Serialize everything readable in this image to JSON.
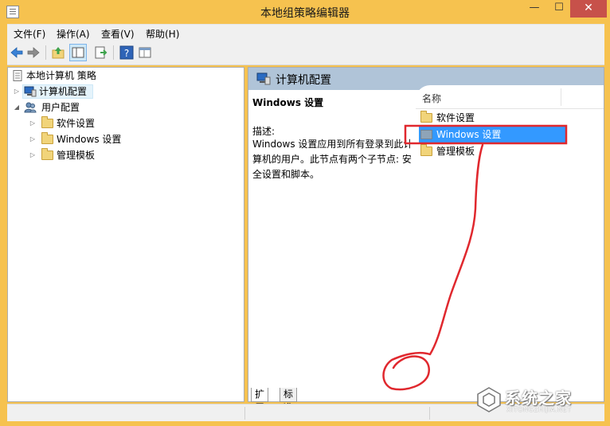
{
  "window": {
    "title": "本地组策略编辑器",
    "minimize_glyph": "—",
    "maximize_glyph": "☐",
    "close_glyph": "✕"
  },
  "menu": [
    {
      "label": "文件(F)"
    },
    {
      "label": "操作(A)"
    },
    {
      "label": "查看(V)"
    },
    {
      "label": "帮助(H)"
    }
  ],
  "toolbar": {
    "icons": [
      "back-icon",
      "forward-icon",
      "up-folder-icon",
      "show-hide-tree-icon",
      "export-list-icon",
      "help-icon",
      "properties-icon"
    ]
  },
  "tree": {
    "root": "本地计算机 策略",
    "computer_config": "计算机配置",
    "user_config": "用户配置",
    "children": [
      {
        "label": "软件设置"
      },
      {
        "label": "Windows 设置"
      },
      {
        "label": "管理模板"
      }
    ]
  },
  "details": {
    "header": "计算机配置",
    "selected_title": "Windows 设置",
    "description_label": "描述:",
    "description_text": "Windows 设置应用到所有登录到此计算机的用户。此节点有两个子节点: 安全设置和脚本。",
    "column_name": "名称",
    "items": [
      {
        "label": "软件设置"
      },
      {
        "label": "Windows 设置"
      },
      {
        "label": "管理模板"
      }
    ],
    "selected_index": 1
  },
  "tabs": [
    {
      "label": "扩展"
    },
    {
      "label": "标准"
    }
  ],
  "annotation": {
    "color": "#e0282e"
  },
  "watermark": {
    "text": "系统之家",
    "subtext": "XITONGZHIJIA.NET"
  }
}
